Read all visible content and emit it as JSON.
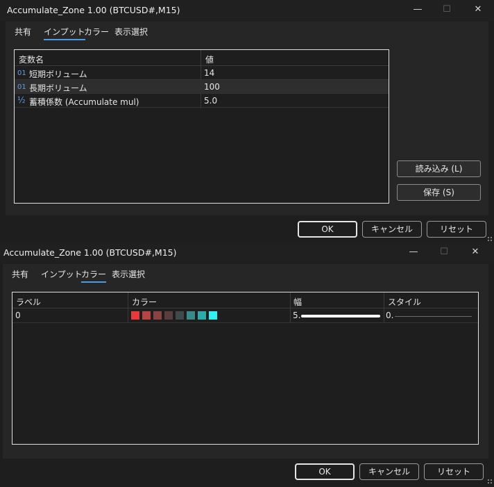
{
  "dialog1": {
    "title": "Accumulate_Zone 1.00 (BTCUSD#,M15)",
    "tabs": [
      "共有",
      "インプット",
      "カラー",
      "表示選択"
    ],
    "active_tab": "インプット",
    "columns": [
      "変数名",
      "値"
    ],
    "rows": [
      {
        "icon": "01",
        "name": "短期ボリューム",
        "value": "14"
      },
      {
        "icon": "01",
        "name": "長期ボリューム",
        "value": "100"
      },
      {
        "icon": "½",
        "name": "蓄積係数 (Accumulate mul)",
        "value": "5.0"
      }
    ],
    "side_buttons": {
      "load": "読み込み (L)",
      "save": "保存 (S)"
    },
    "buttons": {
      "ok": "OK",
      "cancel": "キャンセル",
      "reset": "リセット"
    }
  },
  "dialog2": {
    "title": "Accumulate_Zone 1.00 (BTCUSD#,M15)",
    "tabs": [
      "共有",
      "インプット",
      "カラー",
      "表示選択"
    ],
    "active_tab": "カラー",
    "columns": [
      "ラベル",
      "カラー",
      "幅",
      "スタイル"
    ],
    "row": {
      "label": "0",
      "colors": [
        "#e83a3a",
        "#b54545",
        "#8a4242",
        "#5a3e3e",
        "#3f4a4a",
        "#3a8a8a",
        "#2faaaa",
        "#33f0f0"
      ],
      "width": "5.",
      "style": "0."
    },
    "buttons": {
      "ok": "OK",
      "cancel": "キャンセル",
      "reset": "リセット"
    }
  },
  "window_controls": {
    "minimize": "—",
    "maximize": "☐",
    "close": "✕"
  }
}
